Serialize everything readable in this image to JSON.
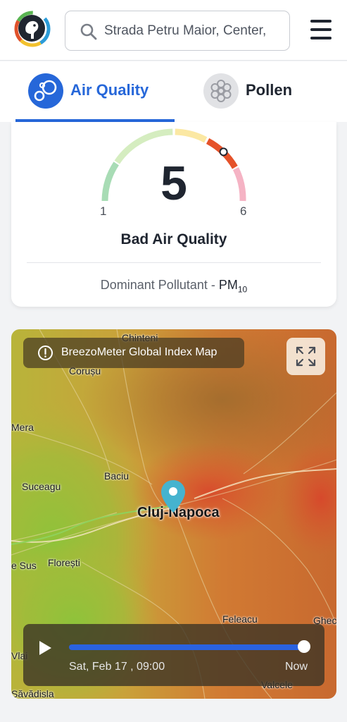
{
  "header": {
    "logo": "breezometer-logo",
    "search": {
      "value": "Strada Petru Maior, Center,",
      "icon": "search-icon"
    },
    "menu_icon": "hamburger-menu-icon"
  },
  "tabs": [
    {
      "label": "Air Quality",
      "icon": "air-bubbles-icon",
      "active": true
    },
    {
      "label": "Pollen",
      "icon": "pollen-flower-icon",
      "active": false
    }
  ],
  "aqi": {
    "value": "5",
    "scale_min": "1",
    "scale_max": "6",
    "description": "Bad Air Quality",
    "dominant_label": "Dominant Pollutant - ",
    "pollutant": "PM",
    "pollutant_sub": "10",
    "colors": [
      "#a8dcb5",
      "#d5edc0",
      "#fbe8a3",
      "#e5522a",
      "#f5b3c4"
    ]
  },
  "map": {
    "title": "BreezoMeter Global Index Map",
    "info_icon": "info-circle-icon",
    "expand_icon": "expand-icon",
    "pin_icon": "location-pin-icon",
    "city": "Cluj-Napoca",
    "places": [
      "Chinteni",
      "Corușu",
      "Mera",
      "Baciu",
      "Suceagu",
      "e Sus",
      "Florești",
      "Feleacu",
      "Ghec",
      "Vlai",
      "Săvădisla",
      "Valcele"
    ],
    "timeline": {
      "time": "Sat, Feb 17 , 09:00",
      "end_label": "Now",
      "progress": 1.0,
      "play_icon": "play-icon"
    }
  }
}
